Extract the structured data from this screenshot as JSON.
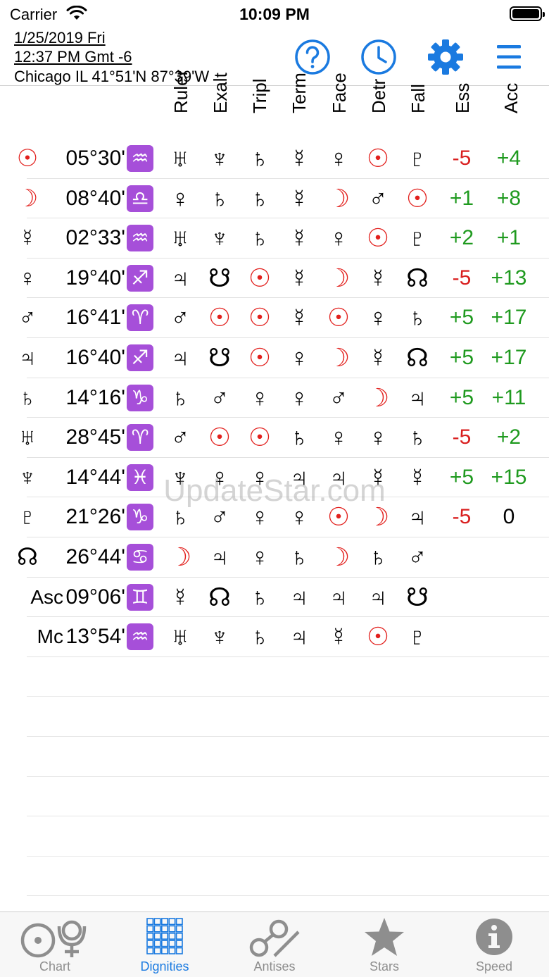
{
  "status": {
    "carrier": "Carrier",
    "time": "10:09 PM"
  },
  "header": {
    "date": "1/25/2019 Fri",
    "time": "12:37 PM Gmt -6",
    "location": "Chicago IL 41°51'N 87°39'W"
  },
  "columns": [
    "Ruler",
    "Exalt",
    "Tripl",
    "Term",
    "Face",
    "Detr",
    "Fall",
    "Ess",
    "Acc"
  ],
  "rows": [
    {
      "planet": "☉",
      "planet_red": true,
      "deg": "05°30'",
      "sign": "♒",
      "g": [
        "♅",
        "♆",
        "♄",
        "☿",
        "♀",
        "☉",
        "♇"
      ],
      "ess": "-5",
      "acc": "+4"
    },
    {
      "planet": "☽",
      "planet_red": true,
      "deg": "08°40'",
      "sign": "♎",
      "g": [
        "♀",
        "♄",
        "♄",
        "☿",
        "☽",
        "♂",
        "☉"
      ],
      "ess": "+1",
      "acc": "+8"
    },
    {
      "planet": "☿",
      "planet_red": false,
      "deg": "02°33'",
      "sign": "♒",
      "g": [
        "♅",
        "♆",
        "♄",
        "☿",
        "♀",
        "☉",
        "♇"
      ],
      "ess": "+2",
      "acc": "+1"
    },
    {
      "planet": "♀",
      "planet_red": false,
      "deg": "19°40'",
      "sign": "♐",
      "g": [
        "♃",
        "☋",
        "☉",
        "☿",
        "☽",
        "☿",
        "☊"
      ],
      "ess": "-5",
      "acc": "+13"
    },
    {
      "planet": "♂",
      "planet_red": false,
      "deg": "16°41'",
      "sign": "♈",
      "g": [
        "♂",
        "☉",
        "☉",
        "☿",
        "☉",
        "♀",
        "♄"
      ],
      "ess": "+5",
      "acc": "+17"
    },
    {
      "planet": "♃",
      "planet_red": false,
      "deg": "16°40'",
      "sign": "♐",
      "g": [
        "♃",
        "☋",
        "☉",
        "♀",
        "☽",
        "☿",
        "☊"
      ],
      "ess": "+5",
      "acc": "+17"
    },
    {
      "planet": "♄",
      "planet_red": false,
      "deg": "14°16'",
      "sign": "♑",
      "g": [
        "♄",
        "♂",
        "♀",
        "♀",
        "♂",
        "☽",
        "♃"
      ],
      "ess": "+5",
      "acc": "+11"
    },
    {
      "planet": "♅",
      "planet_red": false,
      "deg": "28°45'",
      "sign": "♈",
      "g": [
        "♂",
        "☉",
        "☉",
        "♄",
        "♀",
        "♀",
        "♄"
      ],
      "ess": "-5",
      "acc": "+2"
    },
    {
      "planet": "♆",
      "planet_red": false,
      "deg": "14°44'",
      "sign": "♓",
      "g": [
        "♆",
        "♀",
        "♀",
        "♃",
        "♃",
        "☿",
        "☿"
      ],
      "ess": "+5",
      "acc": "+15"
    },
    {
      "planet": "♇",
      "planet_red": false,
      "deg": "21°26'",
      "sign": "♑",
      "g": [
        "♄",
        "♂",
        "♀",
        "♀",
        "☉",
        "☽",
        "♃"
      ],
      "ess": "-5",
      "acc": "0"
    },
    {
      "planet": "☊",
      "planet_red": false,
      "deg": "26°44'",
      "sign": "♋",
      "g": [
        "☽",
        "♃",
        "♀",
        "♄",
        "☽",
        "♄",
        "♂"
      ],
      "ess": "",
      "acc": ""
    },
    {
      "planet": "Asc",
      "planet_red": false,
      "deg": "09°06'",
      "sign": "♊",
      "g": [
        "☿",
        "☊",
        "♄",
        "♃",
        "♃",
        "♃",
        "☋"
      ],
      "ess": "",
      "acc": ""
    },
    {
      "planet": "Mc",
      "planet_red": false,
      "deg": "13°54'",
      "sign": "♒",
      "g": [
        "♅",
        "♆",
        "♄",
        "♃",
        "☿",
        "☉",
        "♇"
      ],
      "ess": "",
      "acc": ""
    }
  ],
  "watermark": "UpdateStar.com",
  "tabs": [
    {
      "label": "Chart",
      "active": false
    },
    {
      "label": "Dignities",
      "active": true
    },
    {
      "label": "Antises",
      "active": false
    },
    {
      "label": "Stars",
      "active": false
    },
    {
      "label": "Speed",
      "active": false
    }
  ],
  "colors": {
    "accent": "#1a7ae0",
    "red_glyph": "#e2201d",
    "negative": "#d91f1f",
    "positive": "#1f9a1f",
    "sign_badge": "#a64fd9"
  }
}
